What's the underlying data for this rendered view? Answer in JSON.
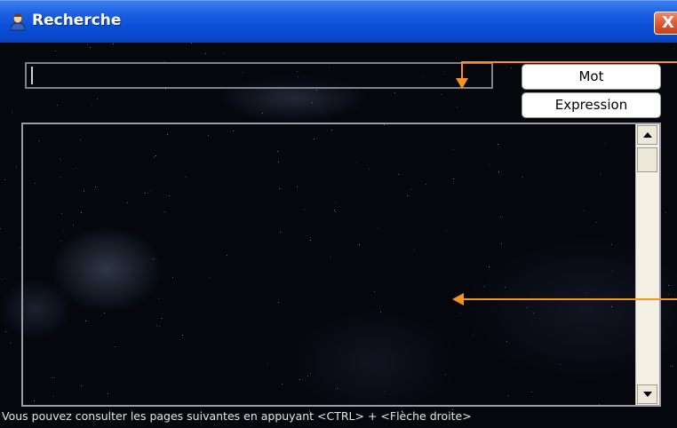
{
  "window": {
    "title": "Recherche",
    "close_label": "X"
  },
  "search": {
    "value": "",
    "placeholder": ""
  },
  "buttons": {
    "word": "Mot",
    "phrase": "Expression"
  },
  "results": {
    "items": []
  },
  "status": {
    "hint": "Vous pouvez consulter les pages suivantes en appuyant <CTRL> + <Flèche droite>"
  },
  "colors": {
    "titlebar": "#0a4fd6",
    "close": "#e05a36",
    "annotation": "#f7941d",
    "background": "#05070d"
  },
  "icons": {
    "title_icon": "user-icon",
    "scroll_up": "arrow-up-icon",
    "scroll_down": "arrow-down-icon",
    "close": "close-icon"
  }
}
